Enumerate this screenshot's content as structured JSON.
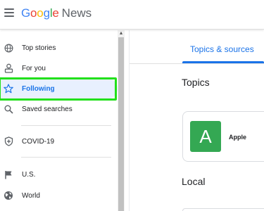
{
  "app": {
    "brand_letters": [
      "G",
      "o",
      "o",
      "g",
      "l",
      "e"
    ],
    "brand_suffix": "News"
  },
  "sidebar": {
    "items": [
      {
        "label": "Top stories",
        "icon": "globe-icon"
      },
      {
        "label": "For you",
        "icon": "person-icon"
      },
      {
        "label": "Following",
        "icon": "star-icon",
        "active": true
      },
      {
        "label": "Saved searches",
        "icon": "search-icon"
      },
      {
        "label": "COVID-19",
        "icon": "shield-icon"
      },
      {
        "label": "U.S.",
        "icon": "flag-icon"
      },
      {
        "label": "World",
        "icon": "world-icon"
      }
    ]
  },
  "main": {
    "tab_label": "Topics & sources",
    "topics_title": "Topics",
    "topic": {
      "avatar_letter": "A",
      "name": "Apple"
    },
    "local_title": "Local"
  },
  "colors": {
    "accent": "#1a73e8",
    "active_bg": "#e8f0fe",
    "highlight": "#22e01b",
    "topic_avatar": "#34a853"
  }
}
